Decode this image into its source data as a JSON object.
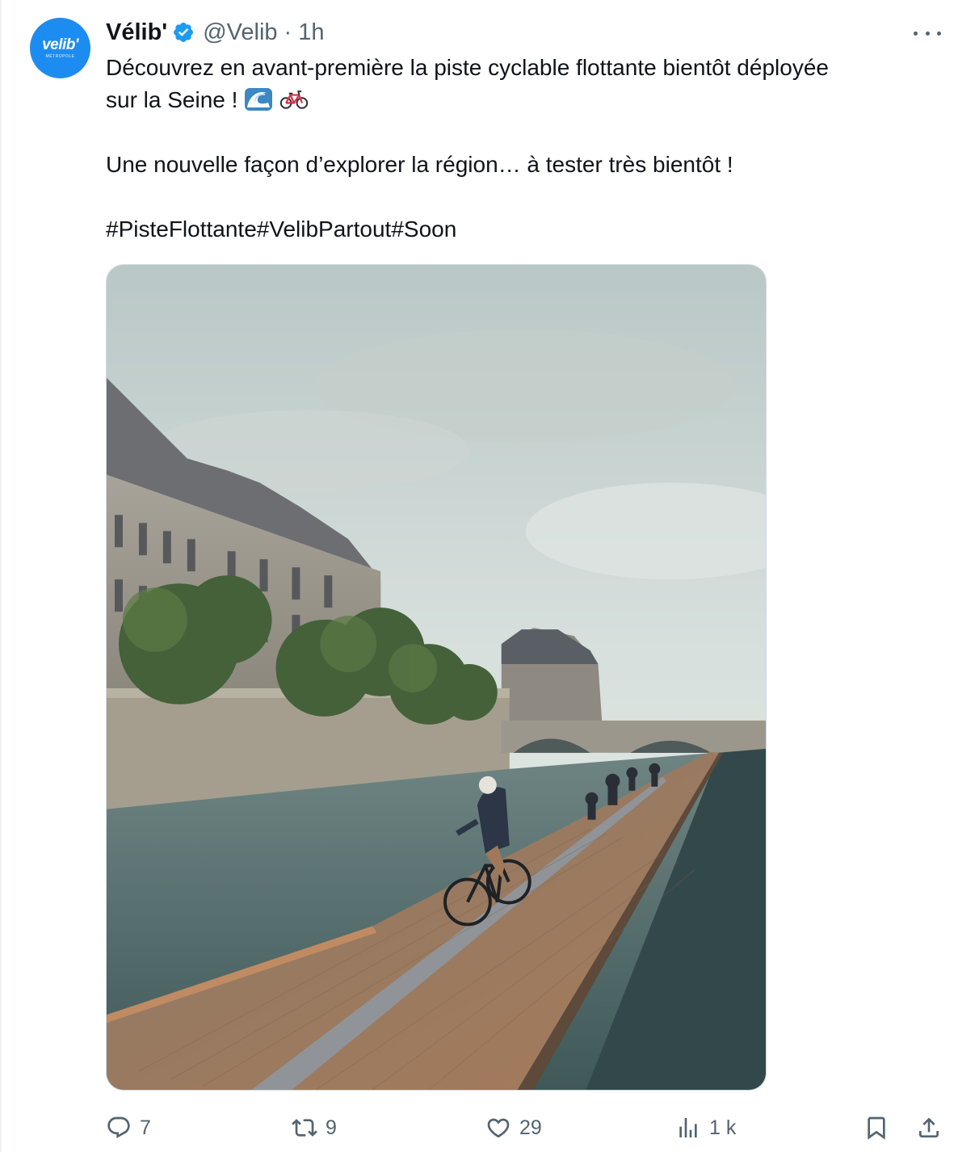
{
  "author": {
    "avatar_text": "velib'",
    "avatar_subtext": "MÉTROPOLE",
    "name": "Vélib'",
    "handle": "@Velib",
    "separator": "·",
    "time": "1h"
  },
  "tweet": {
    "line1": "Découvrez en avant-première la piste cyclable flottante bientôt déployée",
    "line2": "sur la Seine !",
    "emojis": [
      "wave-emoji",
      "bicycle-emoji"
    ],
    "paragraph2": "Une nouvelle façon d’explorer la région… à tester très bientôt !",
    "hashtags": "#PisteFlottante#VelibPartout#Soon"
  },
  "media": {
    "description_icon": "photo-floating-bike-lane-seine"
  },
  "actions": {
    "replies": "7",
    "reposts": "9",
    "likes": "29",
    "views": "1 k"
  },
  "colors": {
    "text": "#0f1419",
    "secondary": "#536471",
    "brand_blue": "#1d8cf0",
    "verified": "#1d9bf0"
  }
}
